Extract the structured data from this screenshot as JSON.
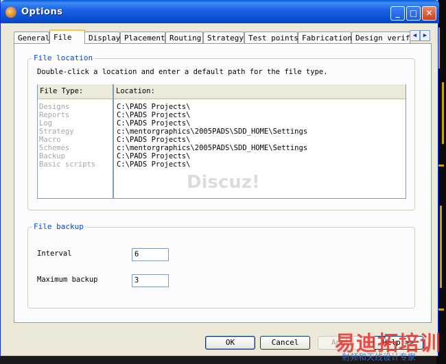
{
  "window": {
    "title": "Options"
  },
  "title_buttons": {
    "minimize": "_",
    "maximize": "□",
    "close": "✕"
  },
  "tabs": [
    "General",
    "File",
    "Display",
    "Placement",
    "Routing",
    "Strategy",
    "Test points",
    "Fabrication",
    "Design verifi"
  ],
  "active_tab": "File",
  "tab_scroll": {
    "left": "◀",
    "right": "▶"
  },
  "file_location": {
    "legend": "File location",
    "hint": "Double-click a location and enter a default path for the file type.",
    "col_type": "File Type:",
    "col_location": "Location:",
    "rows": [
      {
        "type": "Designs",
        "location": "C:\\PADS Projects\\"
      },
      {
        "type": "Reports",
        "location": "C:\\PADS Projects\\"
      },
      {
        "type": "Log",
        "location": "C:\\PADS Projects\\"
      },
      {
        "type": "Strategy",
        "location": "c:\\mentorgraphics\\2005PADS\\SDD_HOME\\Settings"
      },
      {
        "type": "Macro",
        "location": "C:\\PADS Projects\\"
      },
      {
        "type": "Schemes",
        "location": "c:\\mentorgraphics\\2005PADS\\SDD_HOME\\Settings"
      },
      {
        "type": "Backup",
        "location": "C:\\PADS Projects\\"
      },
      {
        "type": "Basic scripts",
        "location": "C:\\PADS Projects\\"
      }
    ]
  },
  "file_backup": {
    "legend": "File backup",
    "interval_label": "Interval",
    "interval_value": "6",
    "max_label": "Maximum backup",
    "max_value": "3"
  },
  "watermark": "Discuz!",
  "buttons": {
    "ok": "OK",
    "cancel": "Cancel",
    "apply": "Apply",
    "help": "Help >>"
  },
  "brand": {
    "main": "易迪拓培训",
    "sub": "射频和天线设计专家"
  }
}
